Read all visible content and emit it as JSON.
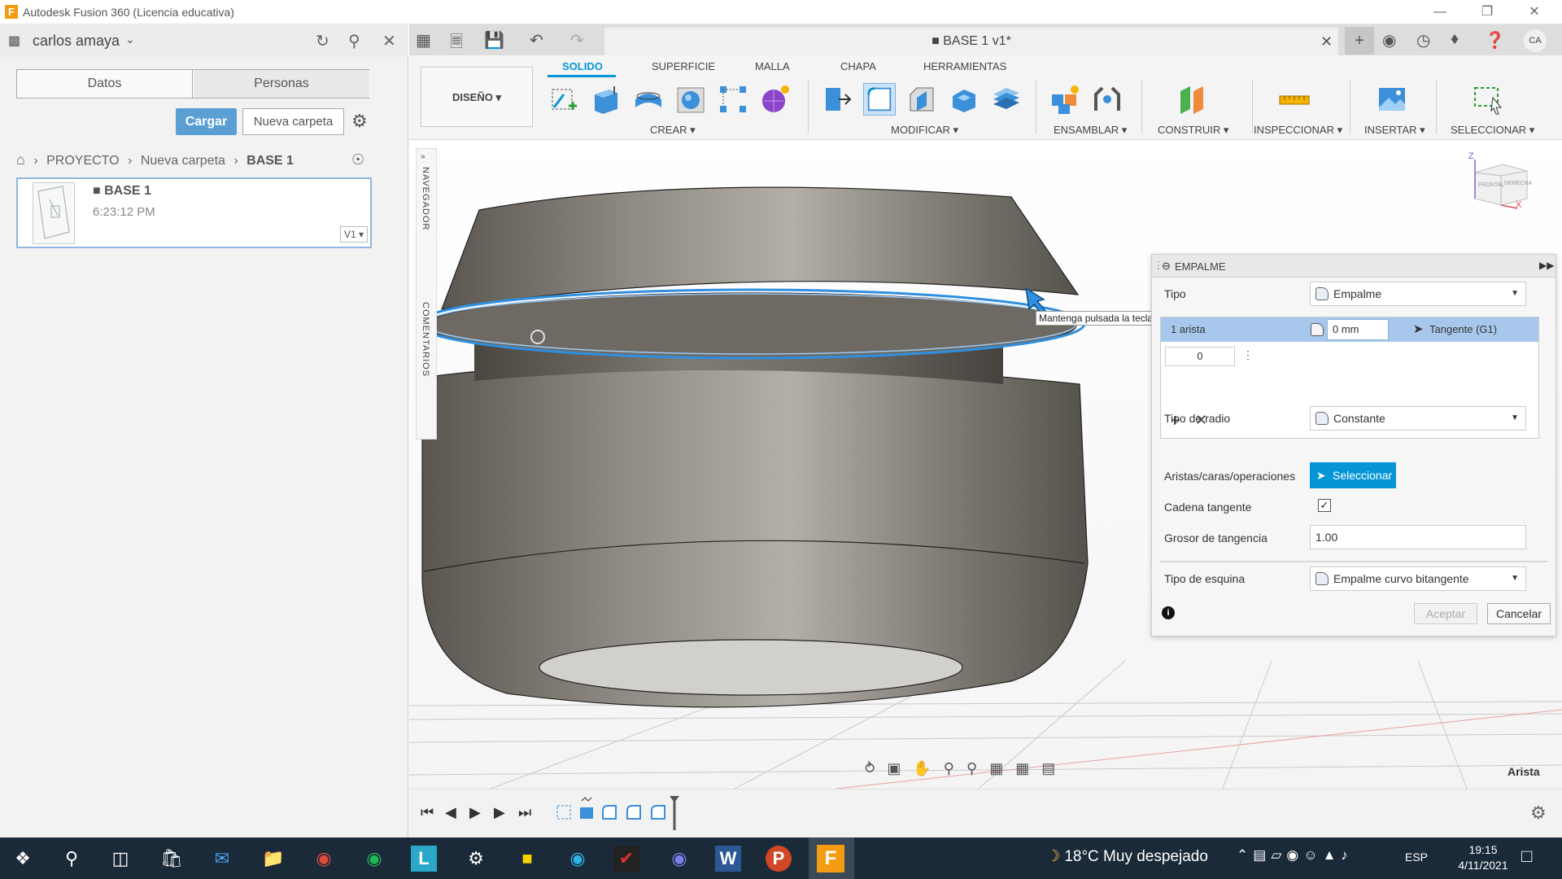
{
  "window": {
    "title": "Autodesk Fusion 360 (Licencia educativa)",
    "logo_letter": "F",
    "minimize": "—",
    "restore": "❐",
    "close": "✕"
  },
  "left_panel": {
    "user_name": "carlos amaya",
    "tabs": [
      "Datos",
      "Personas"
    ],
    "upload_button": "Cargar",
    "new_folder_button": "Nueva carpeta",
    "breadcrumb": [
      "PROYECTO",
      "Nueva carpeta",
      "BASE 1"
    ],
    "file": {
      "name": "BASE 1",
      "time": "6:23:12 PM",
      "version": "V1 ▾"
    }
  },
  "doc": {
    "title": "BASE 1 v1*",
    "user_initials": "CA"
  },
  "toolbar": {
    "workspace_button": "DISEÑO ▾",
    "tabs": [
      "SOLIDO",
      "SUPERFICIE",
      "MALLA",
      "CHAPA",
      "HERRAMIENTAS"
    ],
    "groups": [
      "CREAR ▾",
      "MODIFICAR ▾",
      "ENSAMBLAR ▾",
      "CONSTRUIR ▾",
      "INSPECCIONAR ▾",
      "INSERTAR ▾",
      "SELECCIONAR ▾"
    ]
  },
  "viewport": {
    "side_labels": [
      "NAVEGADOR",
      "COMENTARIOS"
    ],
    "viewcube": {
      "axis_z": "Z",
      "axis_x": "X",
      "front": "FRONTAL",
      "right": "DERECHA"
    },
    "tooltip": "Mantenga pulsada la tecla Ctrl para modificar la selección",
    "status_label": "Arista"
  },
  "dialog": {
    "title": "EMPALME",
    "type_label": "Tipo",
    "type_value": "Empalme",
    "edge_count": "1 arista",
    "edge_radius": "0 mm",
    "edge_continuity": "Tangente (G1)",
    "edge_input": "0",
    "radius_type_label": "Tipo de radio",
    "radius_type_value": "Constante",
    "selection_label": "Aristas/caras/operaciones",
    "select_button": "Seleccionar",
    "tangent_chain_label": "Cadena tangente",
    "tangent_chain_checked": "✓",
    "tangency_weight_label": "Grosor de tangencia",
    "tangency_weight_value": "1.00",
    "corner_type_label": "Tipo de esquina",
    "corner_type_value": "Empalme curvo bitangente",
    "ok_button": "Aceptar",
    "cancel_button": "Cancelar"
  },
  "taskbar": {
    "weather": "18°C  Muy despejado",
    "language": "ESP",
    "time": "19:15",
    "date": "4/11/2021",
    "word_letter": "W",
    "powerpoint_letter": "P",
    "fusion_letter": "F",
    "l_letter": "L"
  },
  "colors": {
    "accent": "#0696d7",
    "taskbar": "#1b2a38",
    "selection_row": "#a7c8ec"
  }
}
